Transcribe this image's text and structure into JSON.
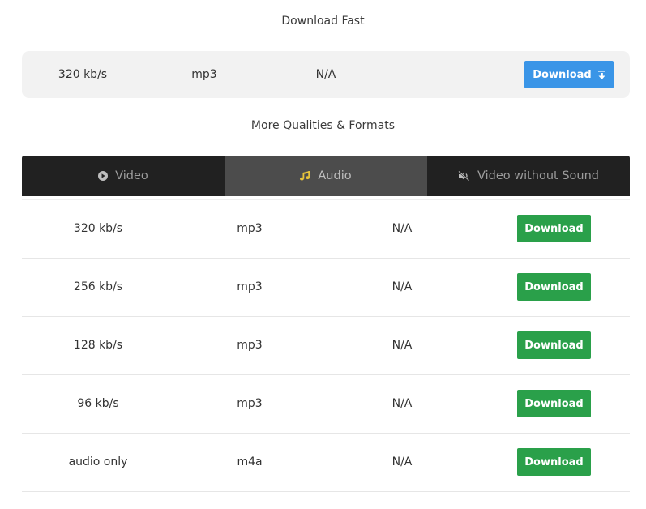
{
  "fast_section": {
    "heading": "Download Fast",
    "bitrate": "320 kb/s",
    "format": "mp3",
    "size": "N/A",
    "button_label": "Download",
    "button_icon": "download-arrow-icon",
    "button_color": "#3a95e7"
  },
  "more_section": {
    "heading": "More Qualities & Formats"
  },
  "tabs": [
    {
      "label": "Video",
      "icon": "play-circle-icon",
      "active": false
    },
    {
      "label": "Audio",
      "icon": "music-note-icon",
      "active": true,
      "icon_color": "#e8c43a"
    },
    {
      "label": "Video without Sound",
      "icon": "volume-mute-icon",
      "active": false
    }
  ],
  "rows": [
    {
      "bitrate": "320 kb/s",
      "format": "mp3",
      "size": "N/A",
      "button_label": "Download"
    },
    {
      "bitrate": "256 kb/s",
      "format": "mp3",
      "size": "N/A",
      "button_label": "Download"
    },
    {
      "bitrate": "128 kb/s",
      "format": "mp3",
      "size": "N/A",
      "button_label": "Download"
    },
    {
      "bitrate": "96 kb/s",
      "format": "mp3",
      "size": "N/A",
      "button_label": "Download"
    },
    {
      "bitrate": "audio only",
      "format": "m4a",
      "size": "N/A",
      "button_label": "Download"
    }
  ],
  "colors": {
    "download_green": "#2aa04a",
    "tab_bar": "#212121",
    "tab_active": "#4c4c4c"
  }
}
